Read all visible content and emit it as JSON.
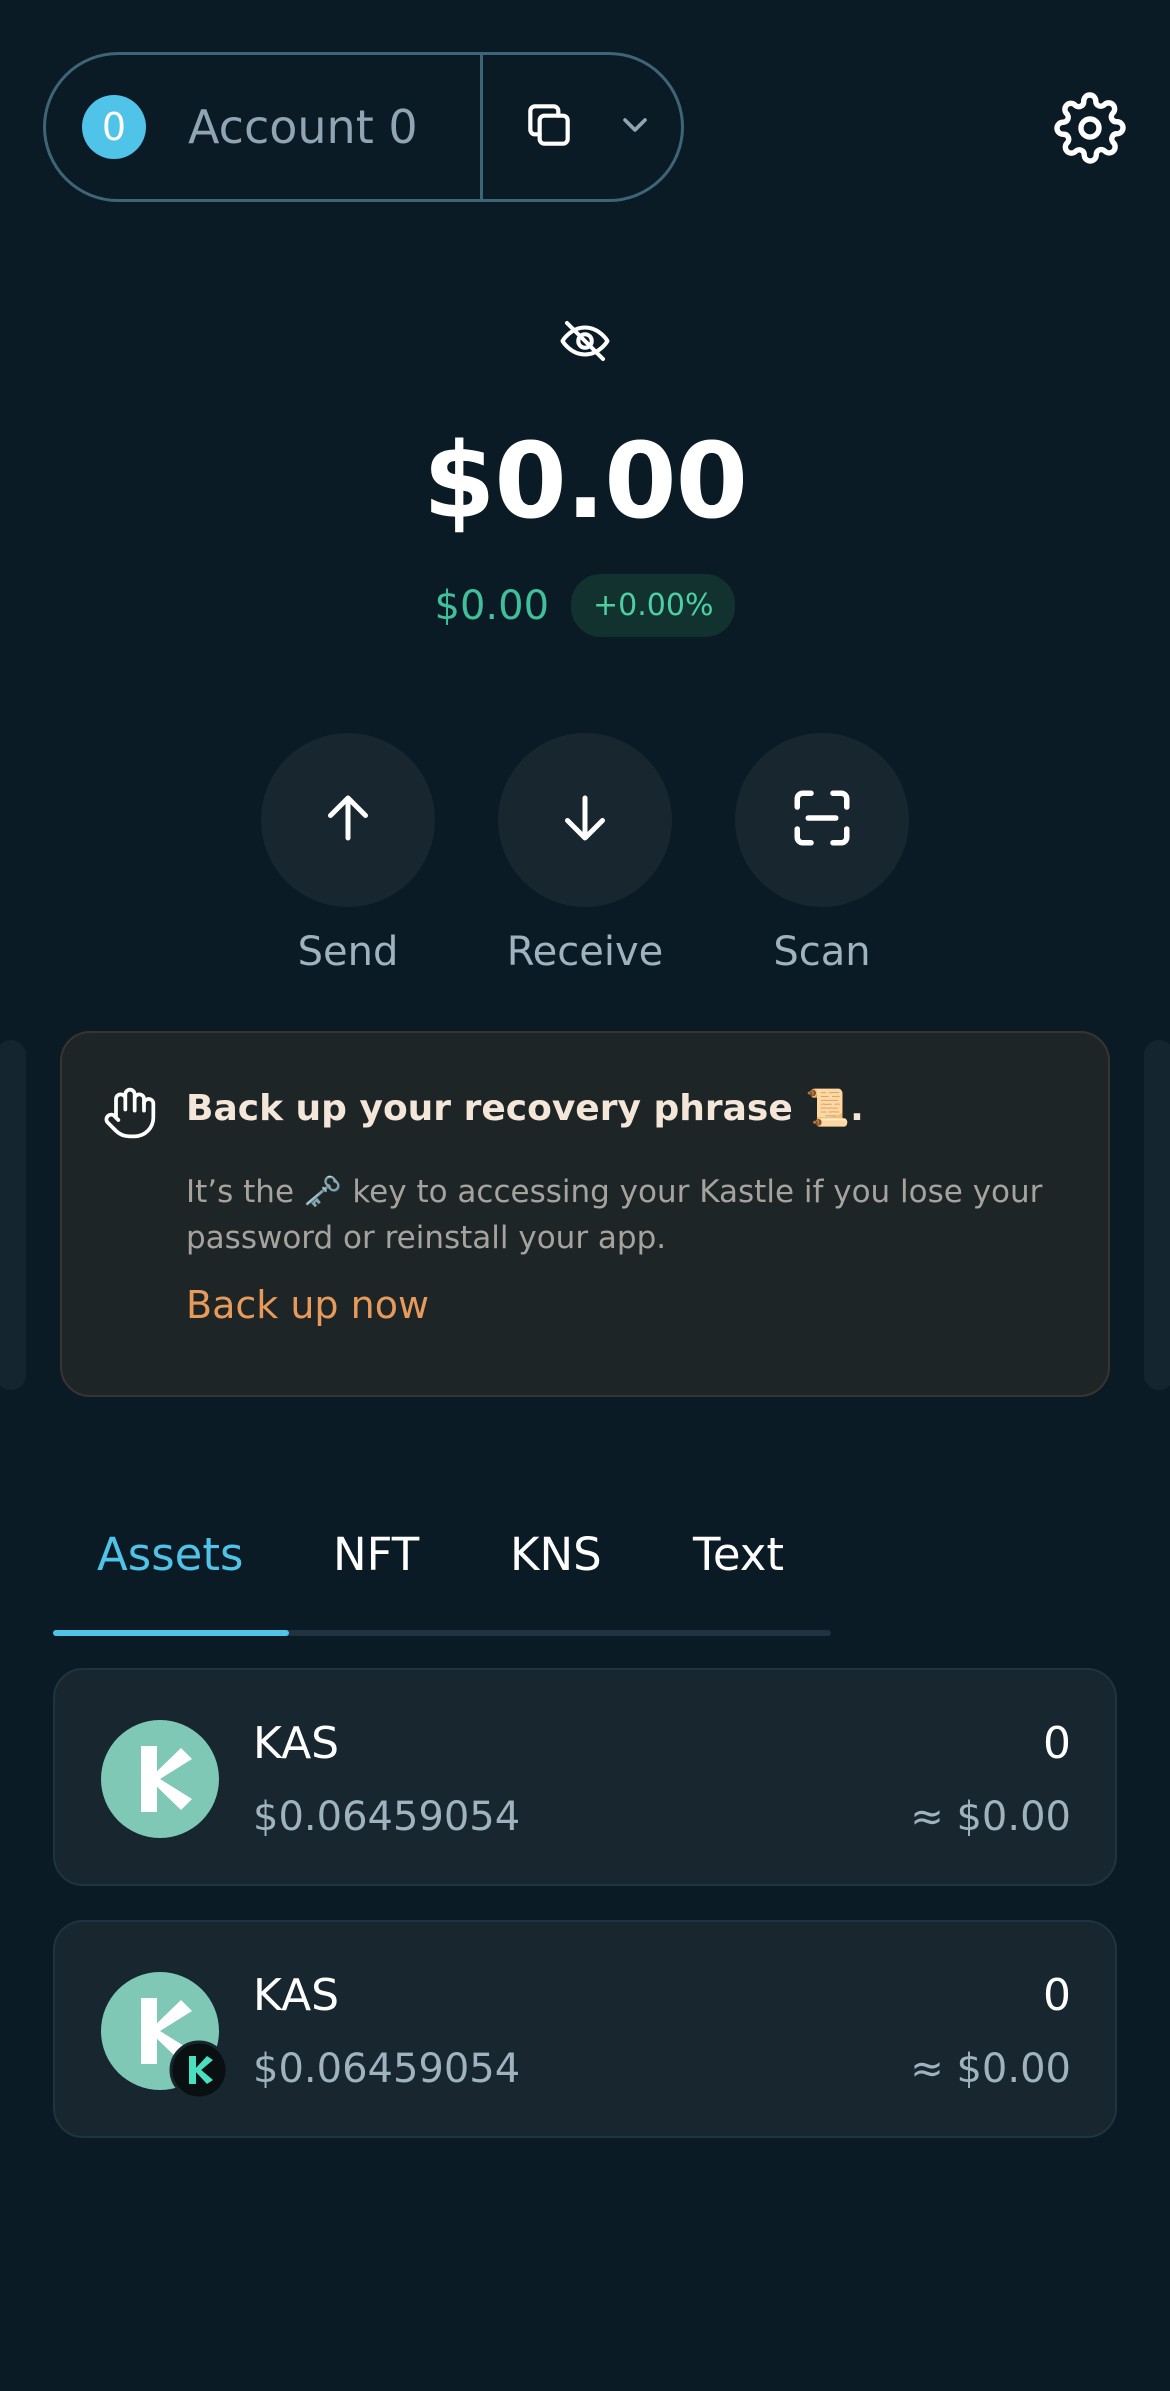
{
  "header": {
    "account_index": "0",
    "account_name": "Account 0"
  },
  "balance": {
    "main": "$0.00",
    "sub_usd": "$0.00",
    "change": "+0.00%"
  },
  "actions": [
    {
      "label": "Send",
      "icon": "arrow-up-icon"
    },
    {
      "label": "Receive",
      "icon": "arrow-down-icon"
    },
    {
      "label": "Scan",
      "icon": "scan-icon"
    }
  ],
  "backup": {
    "title": "Back up your recovery phrase 📜.",
    "text": "It’s the 🗝️ key to accessing your Kastle if you lose your password or reinstall your app.",
    "link": "Back up now"
  },
  "tabs": [
    "Assets",
    "NFT",
    "KNS",
    "Text"
  ],
  "assets": [
    {
      "name": "KAS",
      "price": "$0.06459054",
      "amount": "0",
      "value": "≈ $0.00"
    },
    {
      "name": "KAS",
      "price": "$0.06459054",
      "amount": "0",
      "value": "≈ $0.00"
    }
  ],
  "colors": {
    "background": "#0b1b26",
    "accent": "#4fc3e8",
    "positive": "#3fbf9a",
    "warning_link": "#e89a5a",
    "kas_logo": "#7fc8b6"
  }
}
